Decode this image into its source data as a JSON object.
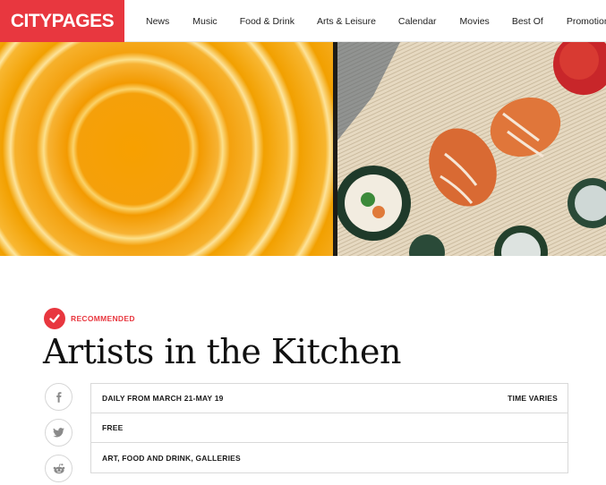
{
  "header": {
    "logo_text": "CITYPAGES",
    "nav": [
      "News",
      "Music",
      "Food & Drink",
      "Arts & Leisure",
      "Calendar",
      "Movies",
      "Best Of",
      "Promotions"
    ]
  },
  "hero": {
    "left_image": "tie-dye-orange-artwork",
    "right_image": "embroidered-sushi-artwork"
  },
  "article": {
    "badge_icon": "checkmark-icon",
    "badge_label": "RECOMMENDED",
    "title": "Artists in the Kitchen",
    "info": {
      "dates": "DAILY FROM MARCH 21-MAY 19",
      "time": "TIME VARIES",
      "price": "FREE",
      "categories": "ART, FOOD AND DRINK, GALLERIES"
    }
  },
  "share": {
    "icons": [
      "facebook-icon",
      "twitter-icon",
      "reddit-icon"
    ]
  },
  "colors": {
    "brand_red": "#e8373f",
    "text": "#1a1a1a",
    "border": "#d9d9d9"
  }
}
